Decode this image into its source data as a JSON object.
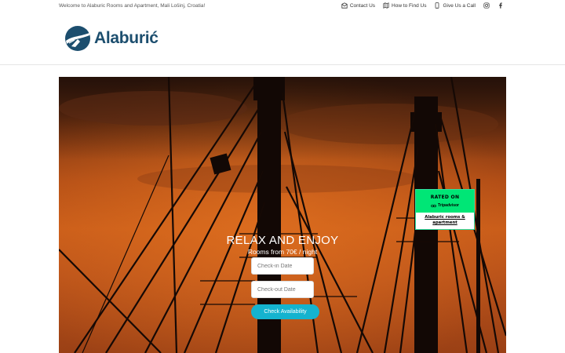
{
  "topbar": {
    "welcome": "Welcome to Alaburic Rooms and Apartment, Mali Lošinj, Croatia!",
    "links": [
      {
        "label": "Contact Us",
        "icon": "envelope-icon"
      },
      {
        "label": "How to Find Us",
        "icon": "map-icon"
      },
      {
        "label": "Give Us a Call",
        "icon": "phone-icon"
      }
    ],
    "social": [
      "instagram-icon",
      "facebook-icon"
    ]
  },
  "header": {
    "logo_text": "Alaburić",
    "brand_color": "#1c4e6e"
  },
  "hero": {
    "title": "RELAX AND ENJOY",
    "subtitle": "Rooms from 70€ / night",
    "checkin_placeholder": "Check-in Date",
    "checkout_placeholder": "Check-out Date",
    "button_label": "Check Availability",
    "button_color": "#14b3cf"
  },
  "tripadvisor": {
    "rated_on": "RATED ON",
    "brand": "Tripadvisor",
    "link_text": "Alaburic rooms & apartment",
    "badge_color": "#00e676"
  }
}
